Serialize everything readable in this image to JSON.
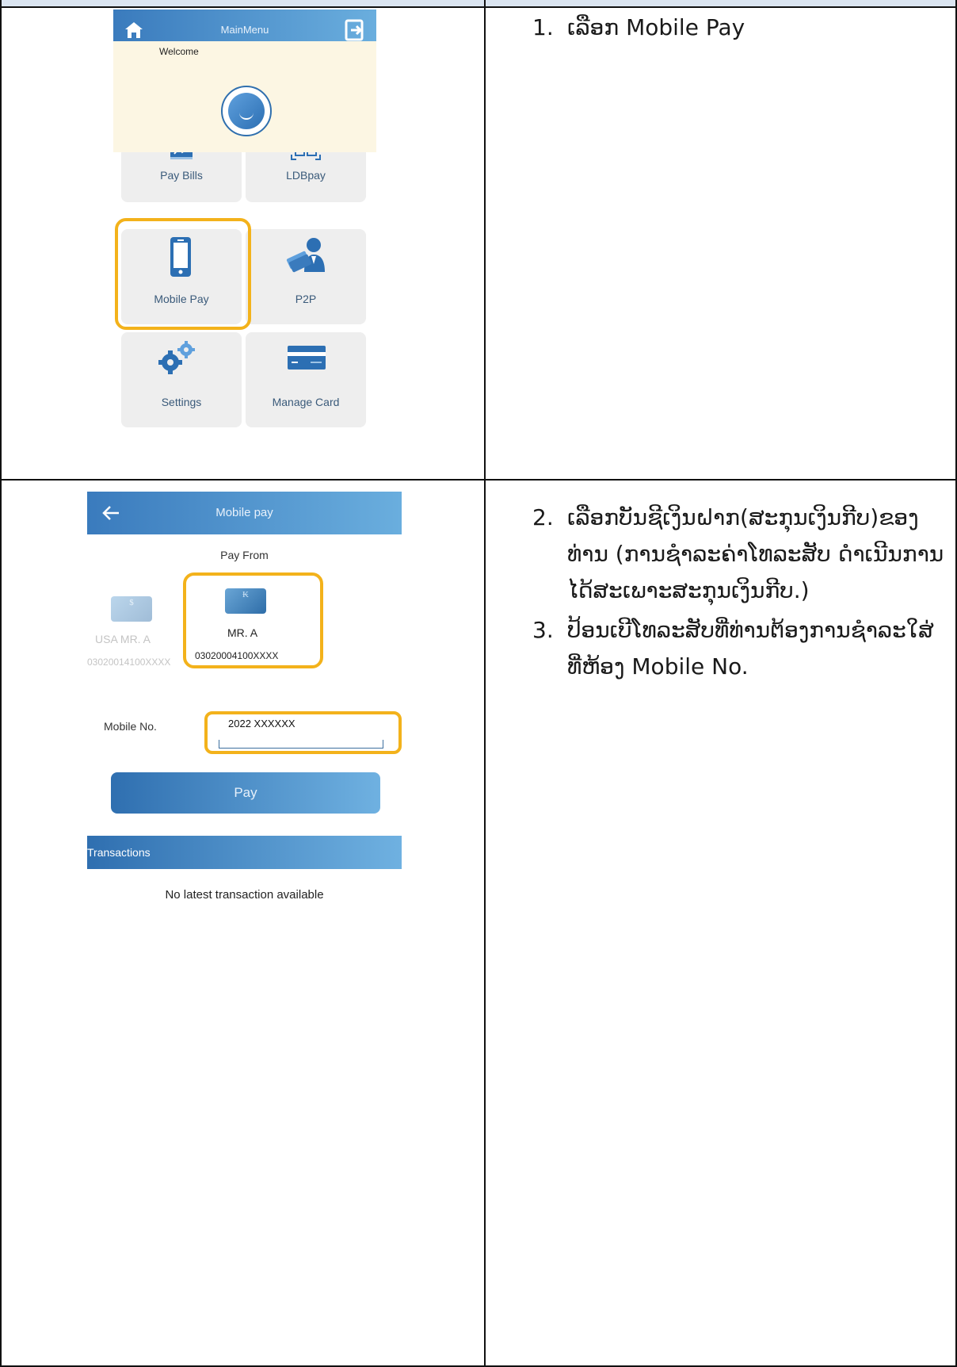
{
  "screen1": {
    "header_title": "MainMenu",
    "welcome": "Welcome",
    "tiles": [
      {
        "label": "Pay Bills",
        "icon": "bill-icon"
      },
      {
        "label": "LDBpay",
        "icon": "qr-code-icon"
      },
      {
        "label": "Mobile Pay",
        "icon": "mobile-phone-icon"
      },
      {
        "label": "P2P",
        "icon": "person-transfer-icon"
      },
      {
        "label": "Settings",
        "icon": "gears-icon"
      },
      {
        "label": "Manage Card",
        "icon": "credit-card-icon"
      }
    ]
  },
  "screen2": {
    "header_title": "Mobile pay",
    "pay_from_label": "Pay From",
    "accounts": [
      {
        "currency_symbol": "$",
        "name": "USA MR. A",
        "number": "03020014100XXXX",
        "selected": false
      },
      {
        "currency_symbol": "₭",
        "name": "MR. A",
        "number": "03020004100XXXX",
        "selected": true
      }
    ],
    "mobile_label": "Mobile No.",
    "mobile_value": "2022 XXXXXX",
    "pay_button": "Pay",
    "transactions_title": "Transactions",
    "transactions_empty": "No latest transaction available"
  },
  "instructions": {
    "step1": {
      "num": "1.",
      "text": "ເລືອກ Mobile Pay"
    },
    "step2": {
      "num": "2.",
      "text": "ເລືອກບັນຊີເງິນຝາກ(ສະກຸນເງິນກີບ)ຂອງ\nທ່ານ (ການຊໍາລະຄ່າໂທລະສັບ ດໍາເນີນການ\nໄດ້ສະເພາະສະກຸນເງິນກີບ.)"
    },
    "step3": {
      "num": "3.",
      "text": "ປ້ອນເບີໂທລະສັບທີ່ທ່ານຕ້ອງການຊໍາລະໃສ່\nທີ່ຫ້ອງ Mobile No."
    }
  },
  "colors": {
    "accent": "#3a7bbd",
    "highlight": "#f3b21b",
    "welcome_bg": "#fcf6e3",
    "tile_bg": "#eeeeee"
  }
}
